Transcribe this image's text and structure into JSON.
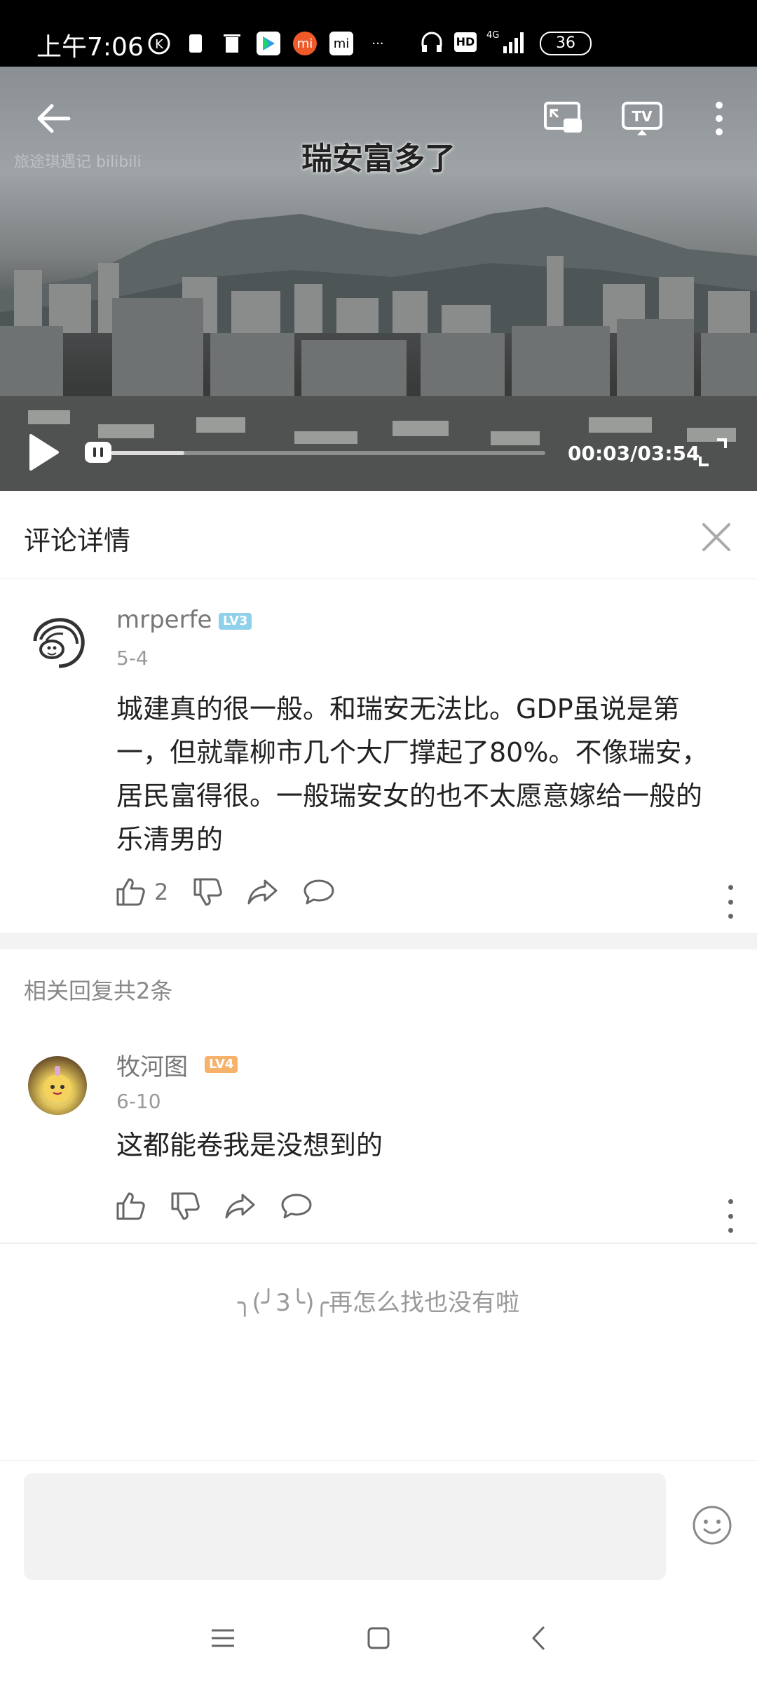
{
  "status_bar": {
    "time": "上午7:06",
    "battery": "36",
    "network": "4G",
    "hd": "HD"
  },
  "video": {
    "caption": "瑞安富多了",
    "watermark": "旅途琪遇记 bilibili",
    "timecode": "00:03/03:54",
    "progress": 0.17
  },
  "panel": {
    "title": "评论详情"
  },
  "main_comment": {
    "username": "mrperfe",
    "level": "LV3",
    "date": "5-4",
    "text": "城建真的很一般。和瑞安无法比。GDP虽说是第一，但就靠柳市几个大厂撑起了80%。不像瑞安，居民富得很。一般瑞安女的也不太愿意嫁给一般的乐清男的",
    "likes": "2"
  },
  "replies_section": {
    "label": "相关回复共2条"
  },
  "reply": {
    "username": "牧河图",
    "level": "LV4",
    "date": "6-10",
    "text": "这都能卷我是没想到的"
  },
  "end_hint": "╮(╯3╰)╭再怎么找也没有啦",
  "input": {
    "placeholder": ""
  },
  "colors": {
    "lv3": "#8fd0ea",
    "lv4": "#f6b26b",
    "video_bg": "#5a5d5e"
  }
}
